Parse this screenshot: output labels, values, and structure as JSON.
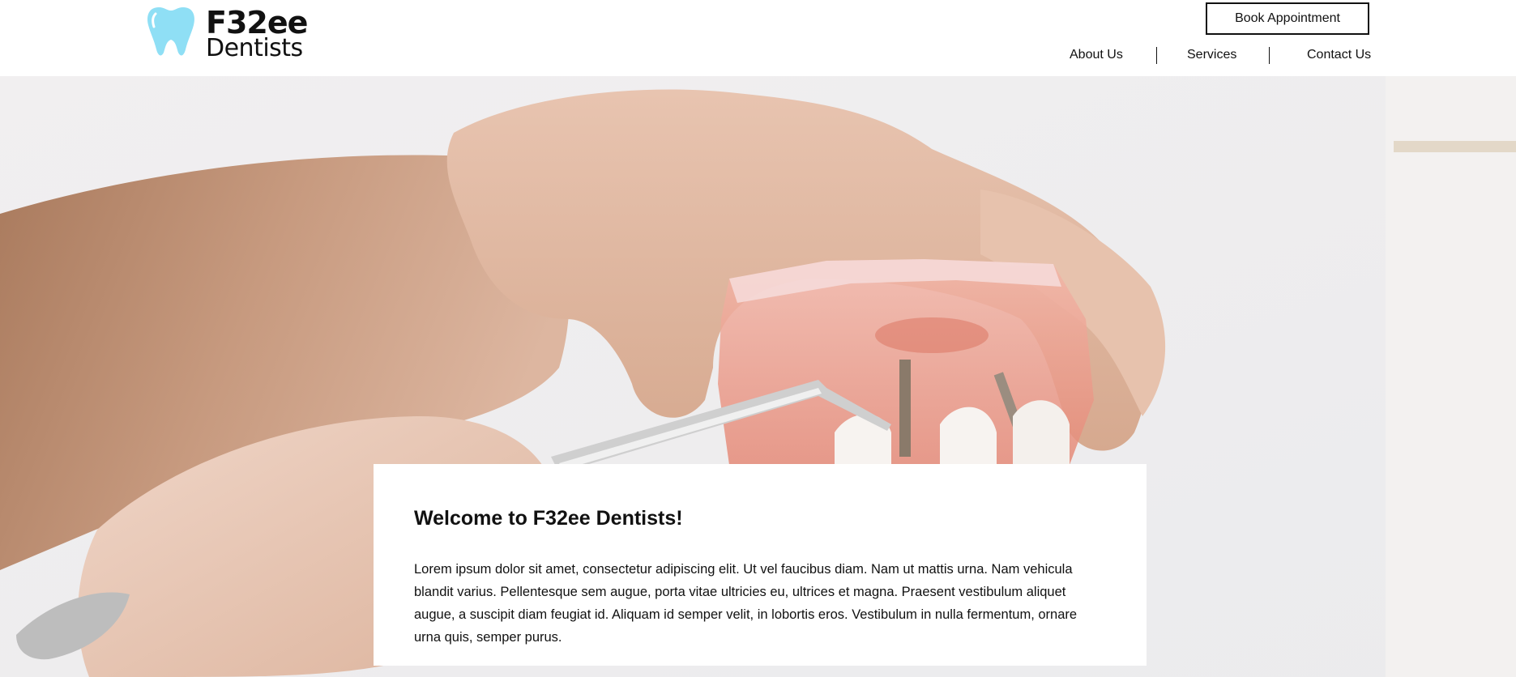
{
  "brand": {
    "name": "F32ee",
    "tagline": "Dentists",
    "accent_color": "#8fdff5",
    "icon": "tooth-icon"
  },
  "header": {
    "cta_label": "Book Appointment"
  },
  "nav": {
    "items": [
      {
        "label": "About Us"
      },
      {
        "label": "Services"
      },
      {
        "label": "Contact Us"
      }
    ]
  },
  "hero": {
    "image": "dental-model-photo"
  },
  "welcome": {
    "title": "Welcome to F32ee Dentists!",
    "body": "Lorem ipsum dolor sit amet, consectetur adipiscing elit. Ut vel faucibus diam. Nam ut mattis urna. Nam vehicula blandit varius. Pellentesque sem augue, porta vitae ultricies eu, ultrices et magna. Praesent vestibulum aliquet augue, a suscipit diam feugiat id. Aliquam id semper velit, in lobortis eros. Vestibulum in nulla fermentum, ornare urna quis, semper purus."
  }
}
